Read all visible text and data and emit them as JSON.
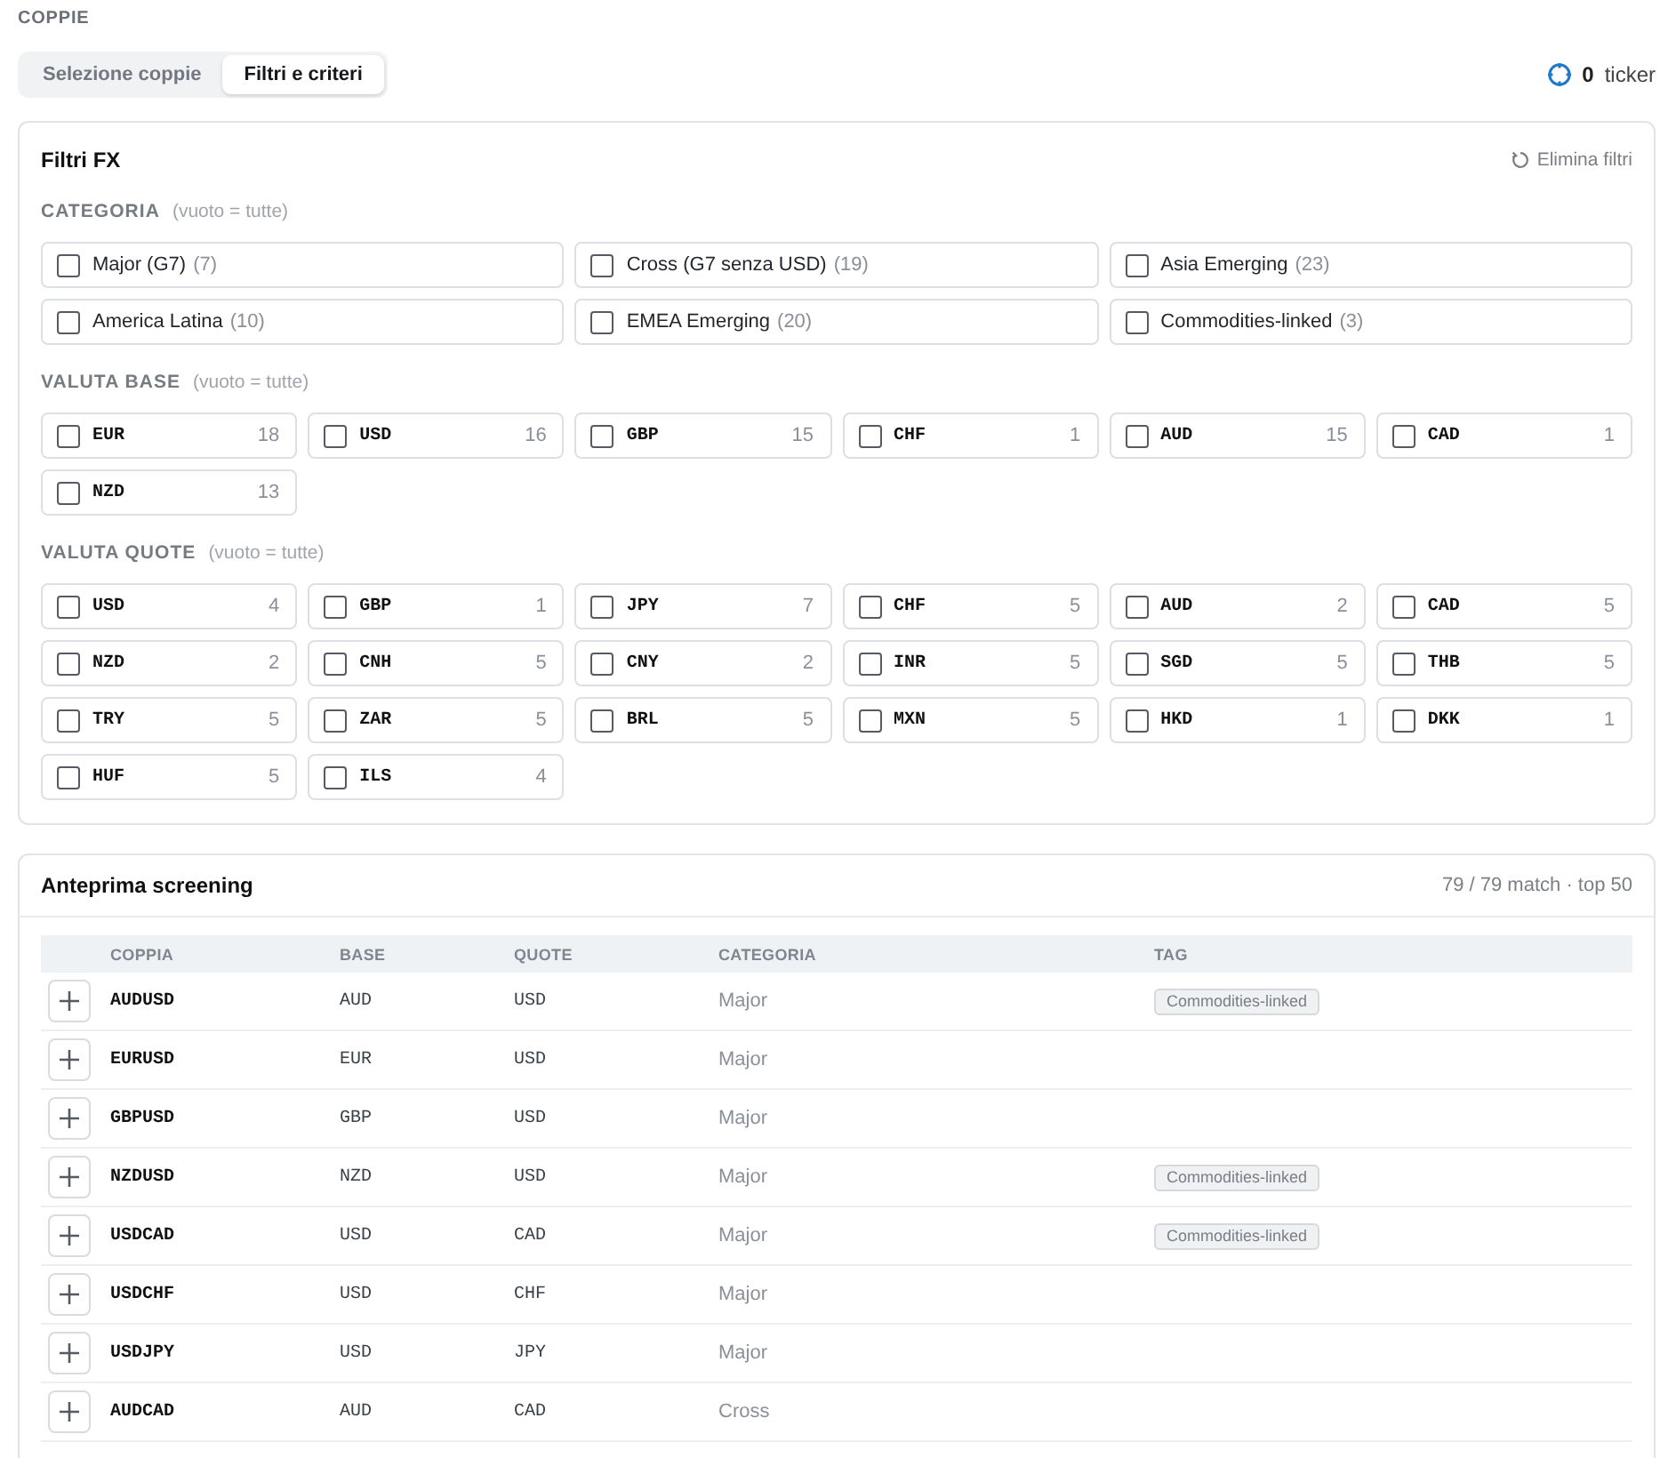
{
  "section_label": "COPPIE",
  "tabs": [
    {
      "label": "Selezione coppie",
      "selected": false
    },
    {
      "label": "Filtri e criteri",
      "selected": true
    }
  ],
  "ticker_counter": {
    "count": "0",
    "label": "ticker"
  },
  "filters": {
    "title": "Filtri FX",
    "clear_action": "Elimina filtri",
    "groups": [
      {
        "kind": "category",
        "label": "CATEGORIA",
        "hint": "(vuoto = tutte)",
        "options": [
          {
            "label": "Major (G7)",
            "count": "(7)",
            "checked": false
          },
          {
            "label": "Cross (G7 senza USD)",
            "count": "(19)",
            "checked": false
          },
          {
            "label": "Asia Emerging",
            "count": "(23)",
            "checked": false
          },
          {
            "label": "America Latina",
            "count": "(10)",
            "checked": false
          },
          {
            "label": "EMEA Emerging",
            "count": "(20)",
            "checked": false
          },
          {
            "label": "Commodities-linked",
            "count": "(3)",
            "checked": false
          }
        ]
      },
      {
        "kind": "currency",
        "label": "VALUTA BASE",
        "hint": "(vuoto = tutte)",
        "options": [
          {
            "label": "EUR",
            "count": "18",
            "checked": false
          },
          {
            "label": "USD",
            "count": "16",
            "checked": false
          },
          {
            "label": "GBP",
            "count": "15",
            "checked": false
          },
          {
            "label": "CHF",
            "count": "1",
            "checked": false
          },
          {
            "label": "AUD",
            "count": "15",
            "checked": false
          },
          {
            "label": "CAD",
            "count": "1",
            "checked": false
          },
          {
            "label": "NZD",
            "count": "13",
            "checked": false
          }
        ]
      },
      {
        "kind": "currency",
        "label": "VALUTA QUOTE",
        "hint": "(vuoto = tutte)",
        "options": [
          {
            "label": "USD",
            "count": "4",
            "checked": false
          },
          {
            "label": "GBP",
            "count": "1",
            "checked": false
          },
          {
            "label": "JPY",
            "count": "7",
            "checked": false
          },
          {
            "label": "CHF",
            "count": "5",
            "checked": false
          },
          {
            "label": "AUD",
            "count": "2",
            "checked": false
          },
          {
            "label": "CAD",
            "count": "5",
            "checked": false
          },
          {
            "label": "NZD",
            "count": "2",
            "checked": false
          },
          {
            "label": "CNH",
            "count": "5",
            "checked": false
          },
          {
            "label": "CNY",
            "count": "2",
            "checked": false
          },
          {
            "label": "INR",
            "count": "5",
            "checked": false
          },
          {
            "label": "SGD",
            "count": "5",
            "checked": false
          },
          {
            "label": "THB",
            "count": "5",
            "checked": false
          },
          {
            "label": "TRY",
            "count": "5",
            "checked": false
          },
          {
            "label": "ZAR",
            "count": "5",
            "checked": false
          },
          {
            "label": "BRL",
            "count": "5",
            "checked": false
          },
          {
            "label": "MXN",
            "count": "5",
            "checked": false
          },
          {
            "label": "HKD",
            "count": "1",
            "checked": false
          },
          {
            "label": "DKK",
            "count": "1",
            "checked": false
          },
          {
            "label": "HUF",
            "count": "5",
            "checked": false
          },
          {
            "label": "ILS",
            "count": "4",
            "checked": false
          }
        ]
      }
    ]
  },
  "preview": {
    "title": "Anteprima screening",
    "summary": "79 / 79 match · top 50",
    "table": {
      "columns": [
        "COPPIA",
        "BASE",
        "QUOTE",
        "CATEGORIA",
        "TAG"
      ],
      "rows": [
        {
          "pair": "AUDUSD",
          "base": "AUD",
          "quote": "USD",
          "category": "Major",
          "tags": [
            "Commodities-linked"
          ]
        },
        {
          "pair": "EURUSD",
          "base": "EUR",
          "quote": "USD",
          "category": "Major"
        },
        {
          "pair": "GBPUSD",
          "base": "GBP",
          "quote": "USD",
          "category": "Major"
        },
        {
          "pair": "NZDUSD",
          "base": "NZD",
          "quote": "USD",
          "category": "Major",
          "tags": [
            "Commodities-linked"
          ]
        },
        {
          "pair": "USDCAD",
          "base": "USD",
          "quote": "CAD",
          "category": "Major",
          "tags": [
            "Commodities-linked"
          ]
        },
        {
          "pair": "USDCHF",
          "base": "USD",
          "quote": "CHF",
          "category": "Major"
        },
        {
          "pair": "USDJPY",
          "base": "USD",
          "quote": "JPY",
          "category": "Major"
        },
        {
          "pair": "AUDCAD",
          "base": "AUD",
          "quote": "CAD",
          "category": "Cross"
        }
      ]
    }
  }
}
